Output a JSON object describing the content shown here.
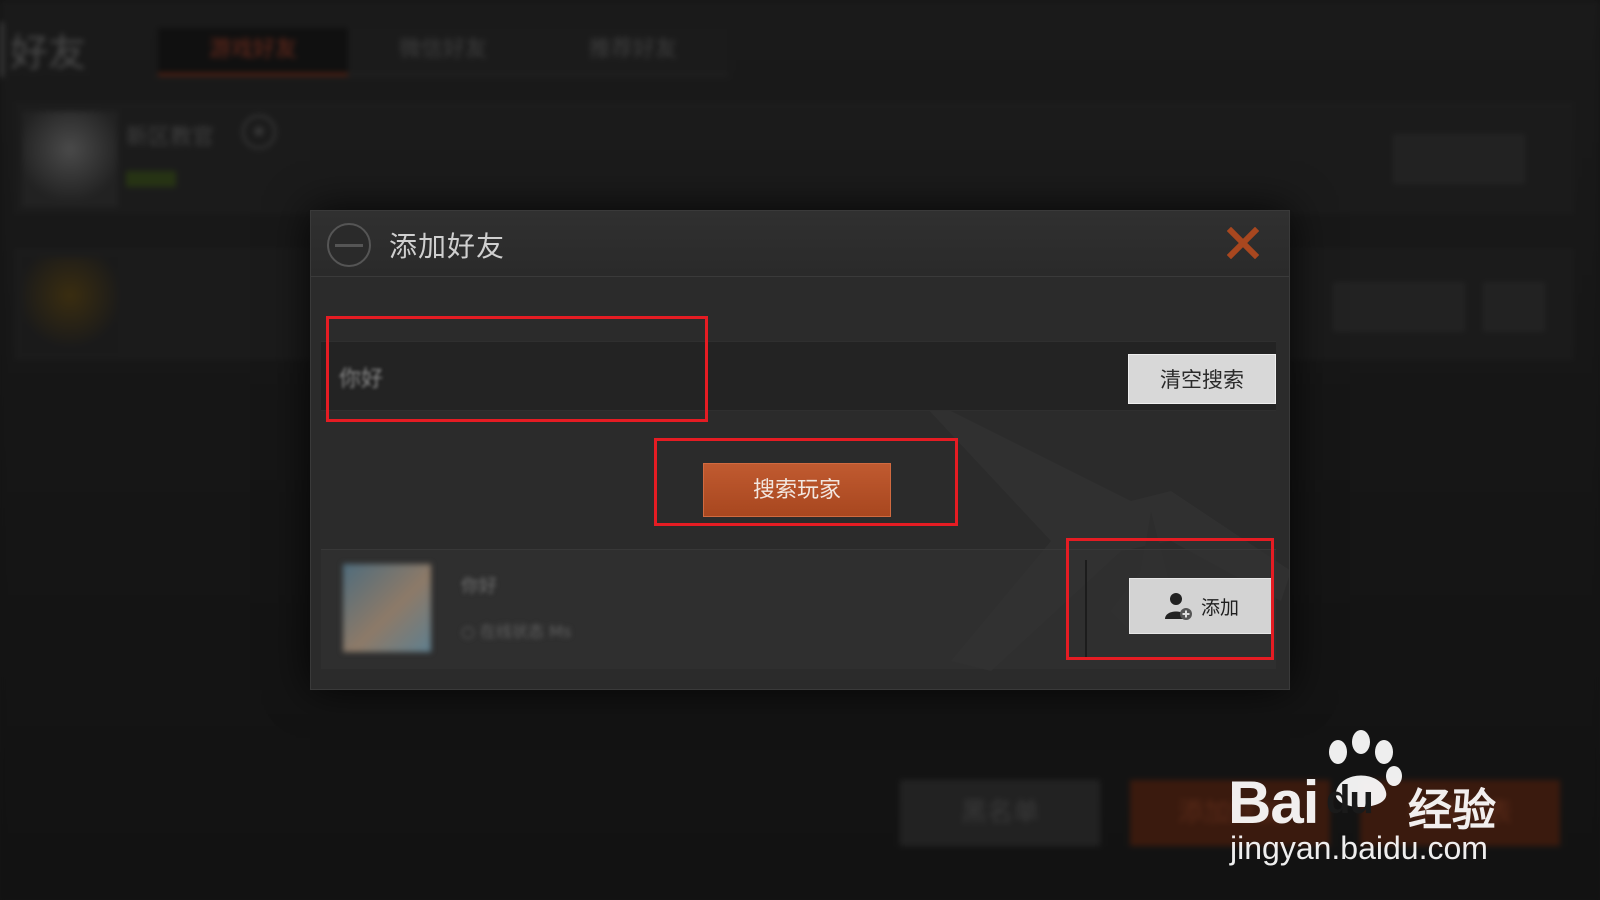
{
  "background": {
    "title": "好友",
    "tabs": [
      {
        "label": "游戏好友",
        "active": true
      },
      {
        "label": "微信好友",
        "active": false
      },
      {
        "label": "推荐好友",
        "active": false
      }
    ],
    "friend_rows": [
      {
        "name": "新区教官"
      }
    ],
    "bottom_buttons": [
      "黑名单",
      "添加好友",
      "申请列表"
    ]
  },
  "dialog": {
    "title": "添加好友",
    "search": {
      "value": "你好",
      "clear_label": "清空搜索"
    },
    "search_button_label": "搜索玩家",
    "result": {
      "name": "你好",
      "meta": "○ 在线状态  Ms",
      "add_label": "添加"
    }
  },
  "watermark": {
    "brand": "Bai",
    "brand_du": "du",
    "product": "经验",
    "url": "jingyan.baidu.com"
  },
  "colors": {
    "accent": "#b4512a",
    "annotation": "#e51c23",
    "close": "#a8471f"
  }
}
